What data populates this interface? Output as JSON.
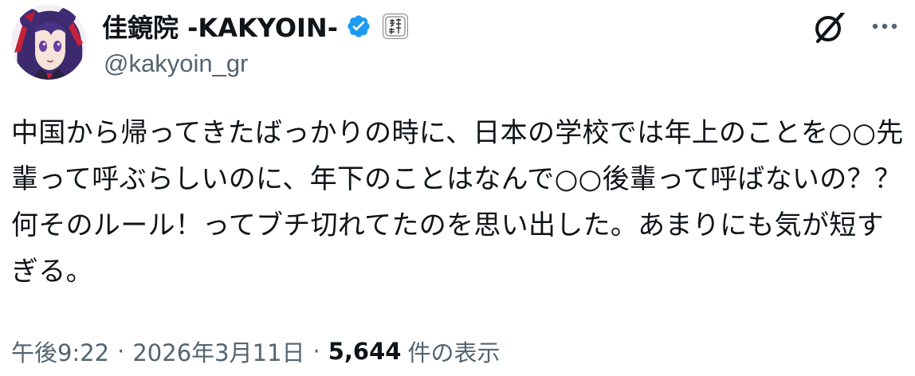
{
  "author": {
    "display_name": "佳鏡院 -KAKYOIN-",
    "handle": "@kakyoin_gr",
    "verified_badge_icon": "verified-check-icon",
    "affiliate_badge_icon": "affiliate-badge-icon",
    "avatar": "avatar-image"
  },
  "actions": {
    "grok_icon": "grok-slash-icon",
    "more_icon": "more-dots-icon"
  },
  "tweet": {
    "text": "中国から帰ってきたばっかりの時に、日本の学校では年上のことを○○先輩って呼ぶらしいのに、年下のことはなんで○○後輩って呼ばないの？？何そのルール！ってブチ切れてたのを思い出した。あまりにも気が短すぎる。"
  },
  "meta": {
    "time": "午後9:22",
    "separator": "·",
    "date": "2026年3月11日",
    "views_count": "5,644",
    "views_label": "件の表示"
  },
  "colors": {
    "text_primary": "#0f1419",
    "text_secondary": "#536471",
    "verified_blue": "#1d9bf0",
    "background": "#ffffff"
  }
}
